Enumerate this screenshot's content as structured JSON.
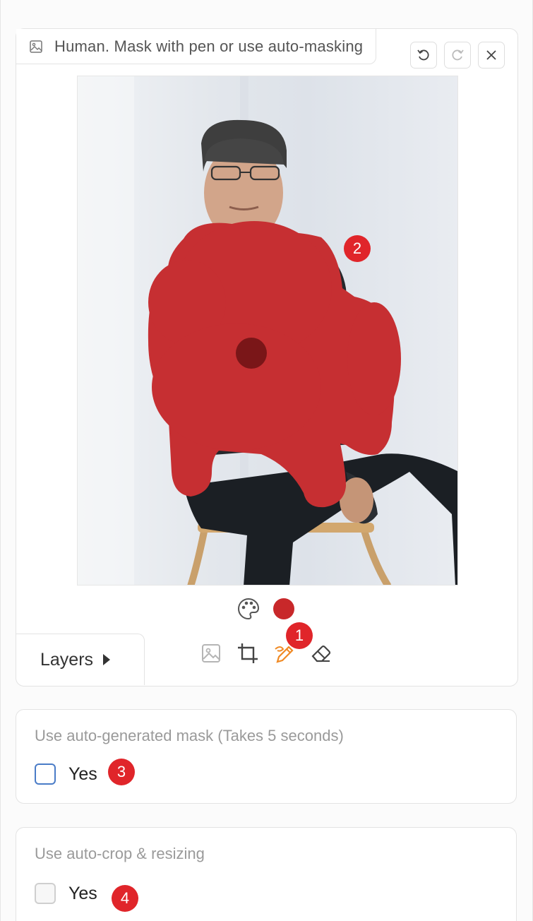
{
  "editor": {
    "title": "Human. Mask with pen or use auto-masking",
    "undo_icon": "undo-icon",
    "redo_icon": "redo-icon",
    "close_icon": "close-icon",
    "brush_color": "#c8282a",
    "layers_label": "Layers",
    "tools": [
      "image-icon",
      "crop-icon",
      "brush-icon",
      "eraser-icon"
    ],
    "active_tool": "brush-icon"
  },
  "badges": {
    "b1": "1",
    "b2": "2",
    "b3": "3",
    "b4": "4"
  },
  "auto_mask": {
    "label": "Use auto-generated mask (Takes 5 seconds)",
    "option": "Yes"
  },
  "auto_crop": {
    "label": "Use auto-crop & resizing",
    "option": "Yes"
  },
  "colors": {
    "accent": "#e0252a",
    "mask": "#c8282a",
    "brush_active": "#f08a24"
  }
}
